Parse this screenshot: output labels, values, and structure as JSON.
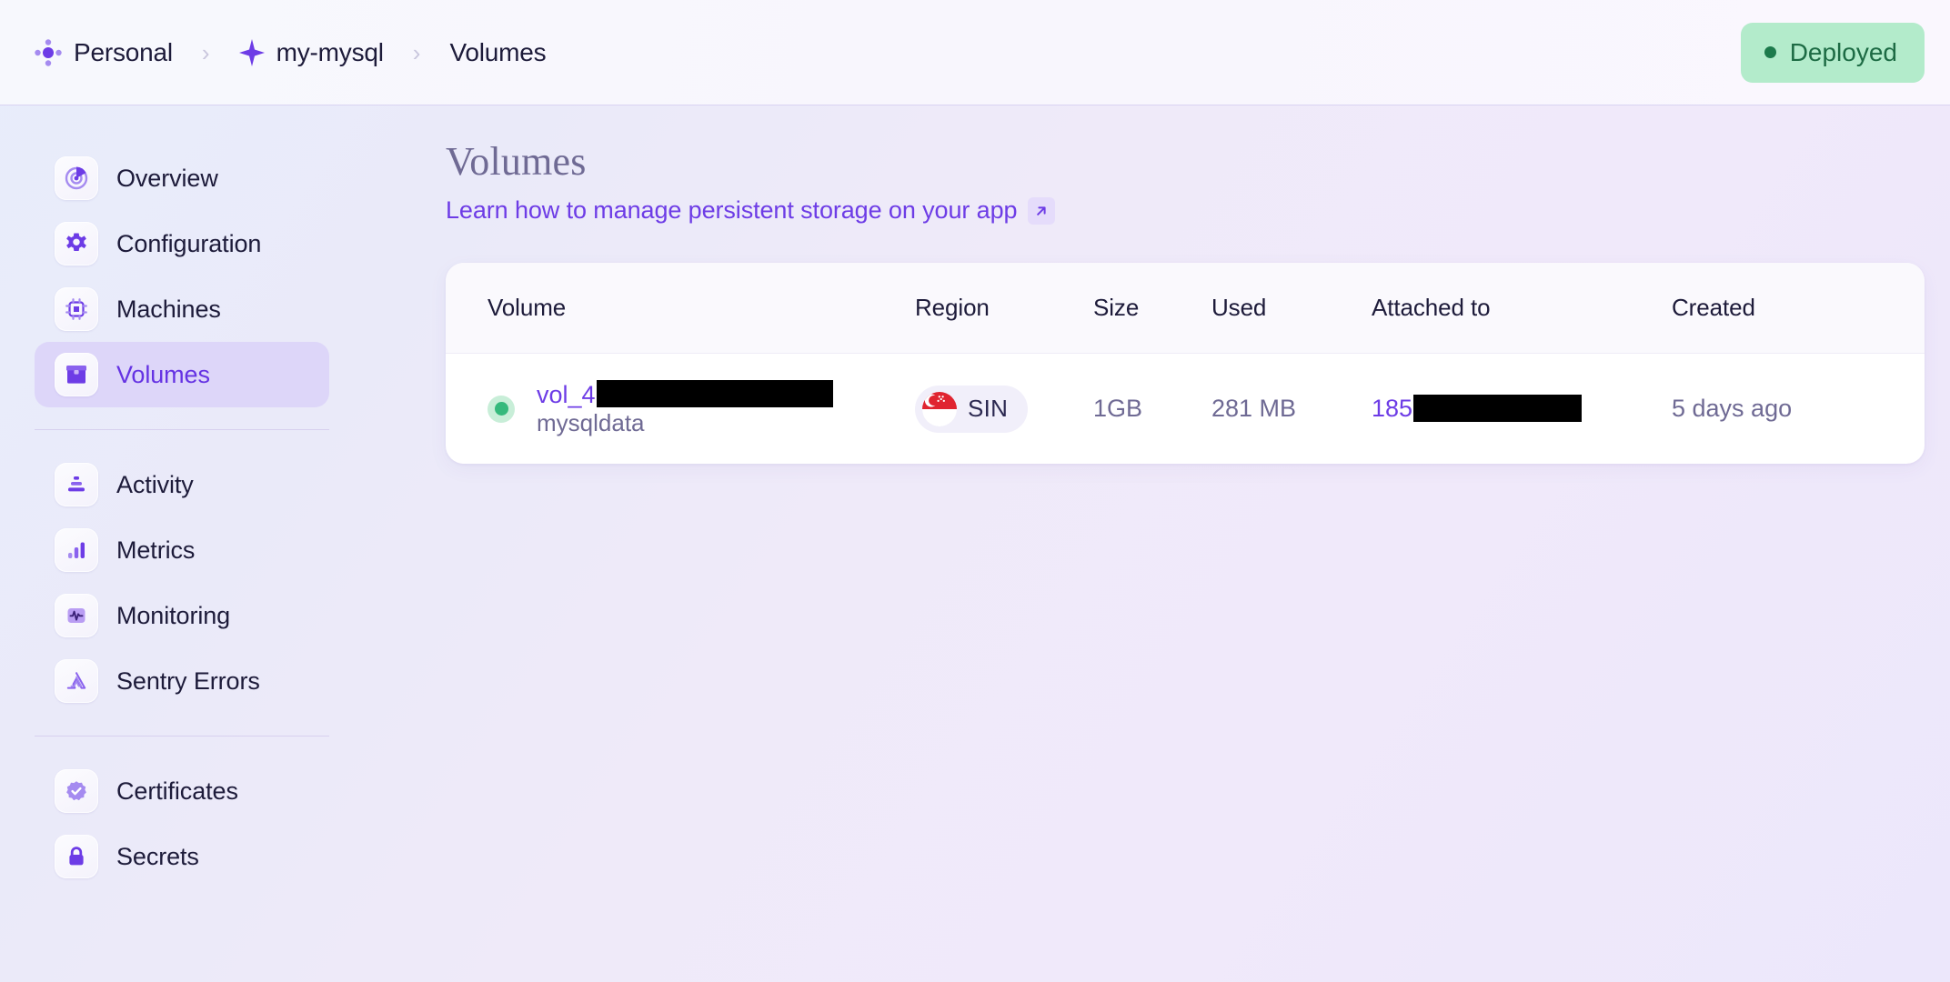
{
  "topbar": {
    "breadcrumb": [
      {
        "label": "Personal",
        "icon": "dots-cluster-icon"
      },
      {
        "label": "my-mysql",
        "icon": "sparkle-icon"
      },
      {
        "label": "Volumes",
        "icon": ""
      }
    ],
    "separator": "›",
    "status": {
      "label": "Deployed",
      "color": "#b3ebcb",
      "text_color": "#1d6b44",
      "dot_color": "#1d7a4c"
    }
  },
  "sidebar": {
    "groups": [
      {
        "items": [
          {
            "label": "Overview",
            "icon": "pie-chart-icon",
            "active": false
          },
          {
            "label": "Configuration",
            "icon": "gear-icon",
            "active": false
          },
          {
            "label": "Machines",
            "icon": "cpu-chip-icon",
            "active": false
          },
          {
            "label": "Volumes",
            "icon": "box-icon",
            "active": true
          }
        ]
      },
      {
        "items": [
          {
            "label": "Activity",
            "icon": "stack-icon",
            "active": false
          },
          {
            "label": "Metrics",
            "icon": "bar-chart-icon",
            "active": false
          },
          {
            "label": "Monitoring",
            "icon": "pulse-icon",
            "active": false
          },
          {
            "label": "Sentry Errors",
            "icon": "sentry-icon",
            "active": false
          }
        ]
      },
      {
        "items": [
          {
            "label": "Certificates",
            "icon": "badge-check-icon",
            "active": false
          },
          {
            "label": "Secrets",
            "icon": "lock-icon",
            "active": false
          }
        ]
      }
    ]
  },
  "main": {
    "title": "Volumes",
    "doc_link": "Learn how to manage persistent storage on your app",
    "doc_link_icon": "external-link-icon",
    "table": {
      "columns": [
        "Volume",
        "Region",
        "Size",
        "Used",
        "Attached to",
        "Created"
      ],
      "rows": [
        {
          "status": "healthy",
          "volume_name": "vol_4",
          "volume_name_redacted": true,
          "volume_label": "mysqldata",
          "region_code": "SIN",
          "region_flag": "singapore-flag-icon",
          "size": "1GB",
          "used": "281 MB",
          "attached_to": "185",
          "attached_to_redacted": true,
          "created": "5 days ago"
        }
      ]
    }
  },
  "colors": {
    "accent": "#6d3ce6",
    "text": "#1d1b3a",
    "muted": "#6f6a94",
    "active_nav_bg": "#ddd6f9",
    "card_bg": "#ffffff",
    "status_ok": "#35b97c"
  }
}
